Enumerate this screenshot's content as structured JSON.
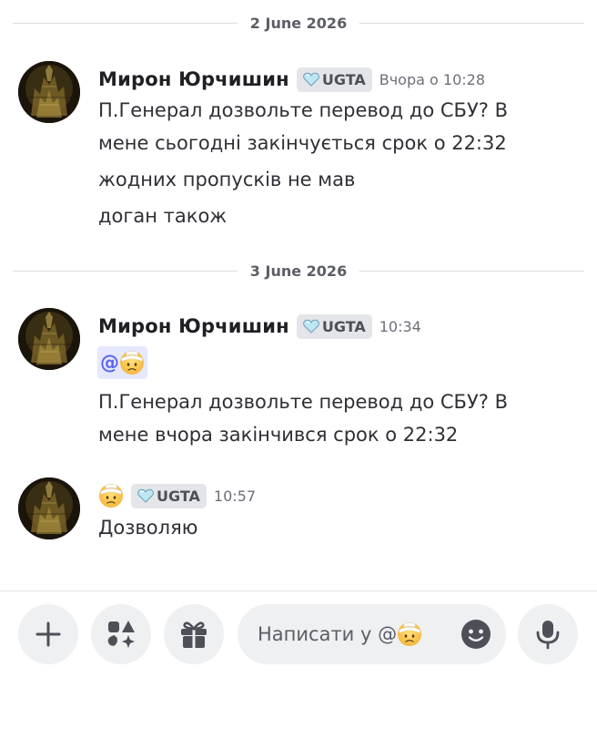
{
  "dates": {
    "first": "2 June 2026",
    "second": "3 June 2026"
  },
  "messages": [
    {
      "author": "Мирон Юрчишин",
      "tag": "UGTA",
      "time": "Вчора о 10:28",
      "lines": [
        "П.Генерал дозвольте перевод до СБУ? В",
        "мене сьогодні закінчується срок о 22:32",
        "жодних пропусків не мав",
        "доган також"
      ]
    },
    {
      "author": "Мирон Юрчишин",
      "tag": "UGTA",
      "time": "10:34",
      "mention": "@",
      "lines": [
        "П.Генерал дозвольте перевод до СБУ? В",
        "мене вчора  закінчився  срок о 22:32"
      ]
    },
    {
      "author": "",
      "tag": "UGTA",
      "time": "10:57",
      "lines": [
        "Дозволяю"
      ]
    }
  ],
  "composer": {
    "placeholder": "Написати у @",
    "buttons": [
      "plus-icon",
      "apps-icon",
      "gift-icon",
      "emoji-icon",
      "microphone-icon"
    ]
  },
  "colors": {
    "mention_bg": "#e6e8fd",
    "mention_text": "#5865f2",
    "tag_bg": "#e3e5e8",
    "button_bg": "#eef0f2"
  }
}
